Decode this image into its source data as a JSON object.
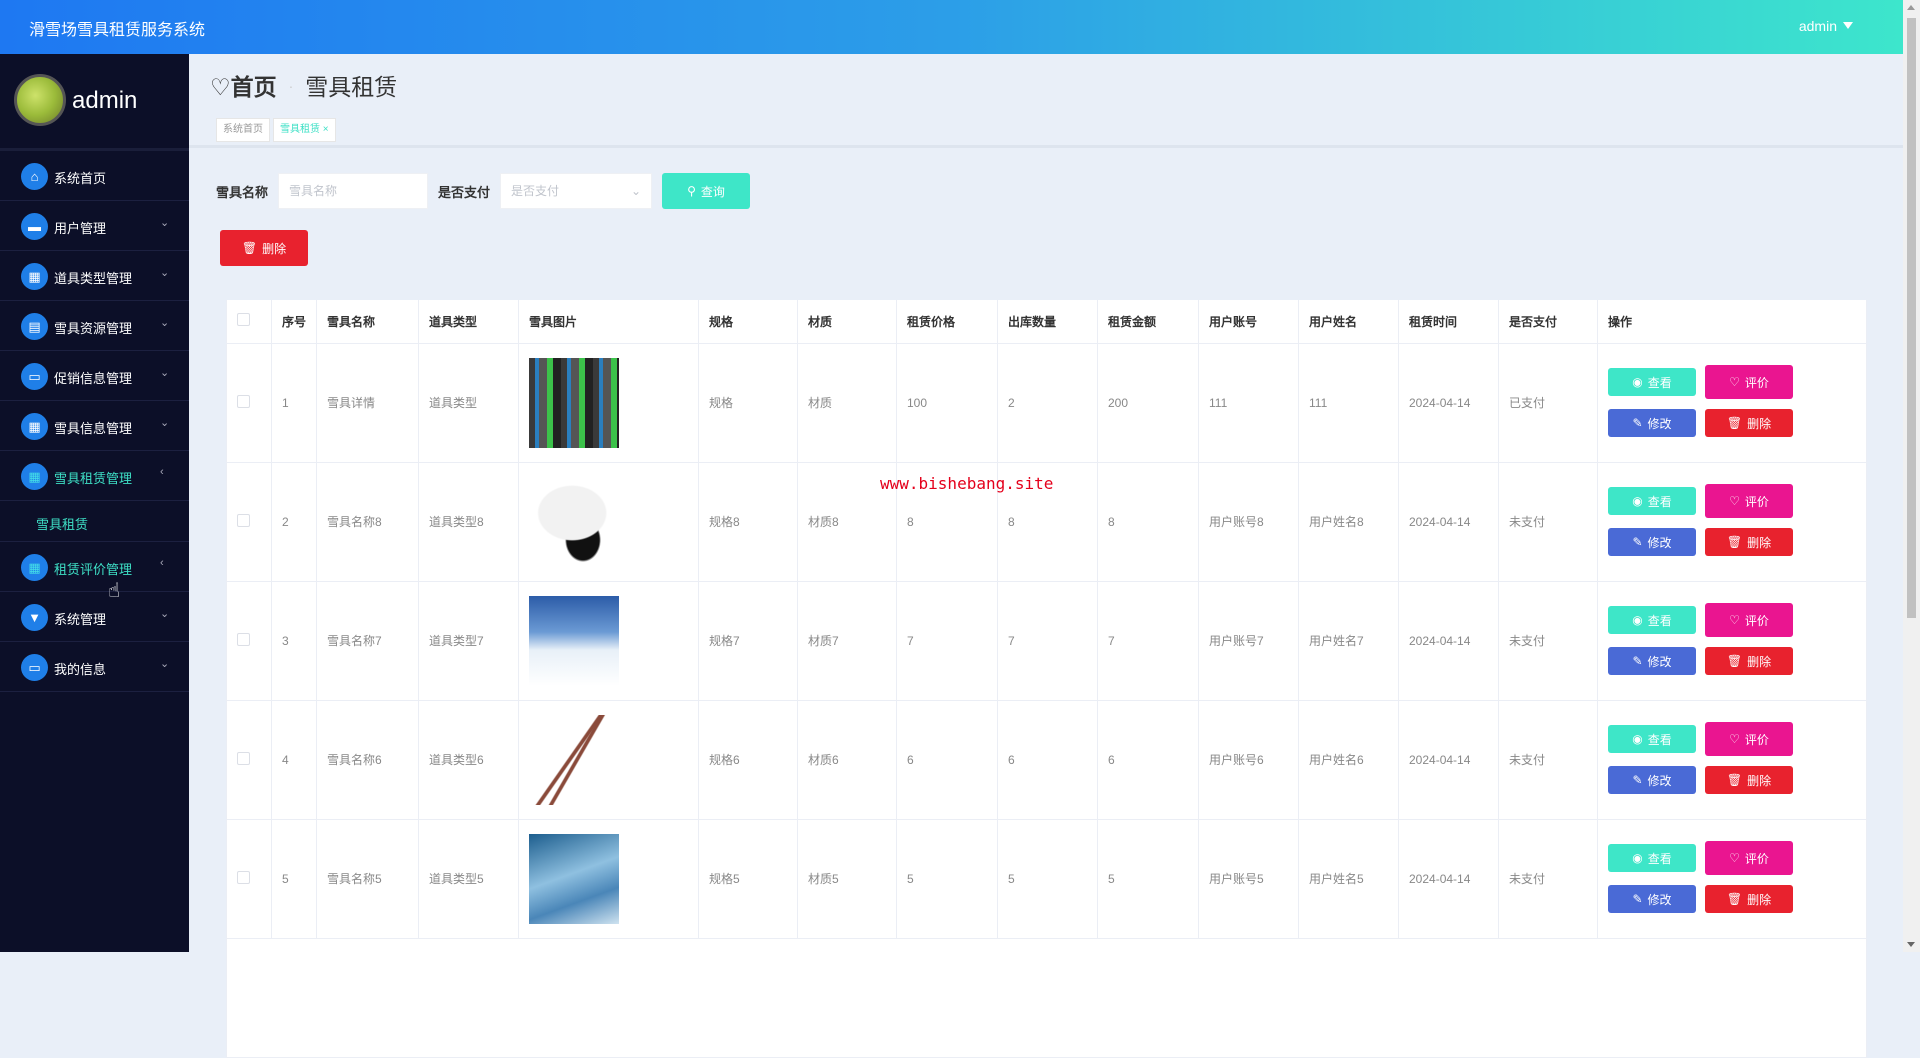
{
  "header": {
    "title": "滑雪场雪具租赁服务系统",
    "user": "admin"
  },
  "sidebar": {
    "username": "admin",
    "items": [
      {
        "label": "系统首页",
        "icon": "home-icon",
        "glyph": "⌂"
      },
      {
        "label": "用户管理",
        "icon": "briefcase-icon",
        "glyph": "▬",
        "arrow": "⌄"
      },
      {
        "label": "道具类型管理",
        "icon": "grid-icon",
        "glyph": "▦",
        "arrow": "⌄"
      },
      {
        "label": "雪具资源管理",
        "icon": "clipboard-icon",
        "glyph": "▤",
        "arrow": "⌄"
      },
      {
        "label": "促销信息管理",
        "icon": "message-icon",
        "glyph": "▭",
        "arrow": "⌄"
      },
      {
        "label": "雪具信息管理",
        "icon": "apps-icon",
        "glyph": "▦",
        "arrow": "⌄"
      },
      {
        "label": "雪具租赁管理",
        "icon": "grid-icon",
        "glyph": "▦",
        "arrow": "‹"
      },
      {
        "label": "租赁评价管理",
        "icon": "grid-icon",
        "glyph": "▦",
        "arrow": "‹"
      },
      {
        "label": "系统管理",
        "icon": "brush-icon",
        "glyph": "▼",
        "arrow": "⌄"
      },
      {
        "label": "我的信息",
        "icon": "card-icon",
        "glyph": "▭",
        "arrow": "⌄"
      }
    ],
    "submenu": "雪具租赁"
  },
  "breadcrumb": {
    "home": "首页",
    "current": "雪具租赁"
  },
  "tabs": [
    {
      "label": "系统首页"
    },
    {
      "label": "雪具租赁 ×"
    }
  ],
  "search": {
    "name_label": "雪具名称",
    "name_placeholder": "雪具名称",
    "pay_label": "是否支付",
    "pay_placeholder": "是否支付",
    "query": "查询"
  },
  "delete_label": "删除",
  "table": {
    "headers": [
      "序号",
      "雪具名称",
      "道具类型",
      "雪具图片",
      "规格",
      "材质",
      "租赁价格",
      "出库数量",
      "租赁金额",
      "用户账号",
      "用户姓名",
      "租赁时间",
      "是否支付",
      "操作"
    ],
    "rows": [
      [
        "1",
        "雪具详情",
        "道具类型",
        "skis",
        "规格",
        "材质",
        "100",
        "2",
        "200",
        "111",
        "111",
        "2024-04-14",
        "已支付"
      ],
      [
        "2",
        "雪具名称8",
        "道具类型8",
        "helmet",
        "规格8",
        "材质8",
        "8",
        "8",
        "8",
        "用户账号8",
        "用户姓名8",
        "2024-04-14",
        "未支付"
      ],
      [
        "3",
        "雪具名称7",
        "道具类型7",
        "snow",
        "规格7",
        "材质7",
        "7",
        "7",
        "7",
        "用户账号7",
        "用户姓名7",
        "2024-04-14",
        "未支付"
      ],
      [
        "4",
        "雪具名称6",
        "道具类型6",
        "poles",
        "规格6",
        "材质6",
        "6",
        "6",
        "6",
        "用户账号6",
        "用户姓名6",
        "2024-04-14",
        "未支付"
      ],
      [
        "5",
        "雪具名称5",
        "道具类型5",
        "cannon",
        "规格5",
        "材质5",
        "5",
        "5",
        "5",
        "用户账号5",
        "用户姓名5",
        "2024-04-14",
        "未支付"
      ]
    ],
    "actions": {
      "view": "查看",
      "rate": "评价",
      "edit": "修改",
      "delete": "删除"
    }
  },
  "watermark": "www.bishebang.site"
}
